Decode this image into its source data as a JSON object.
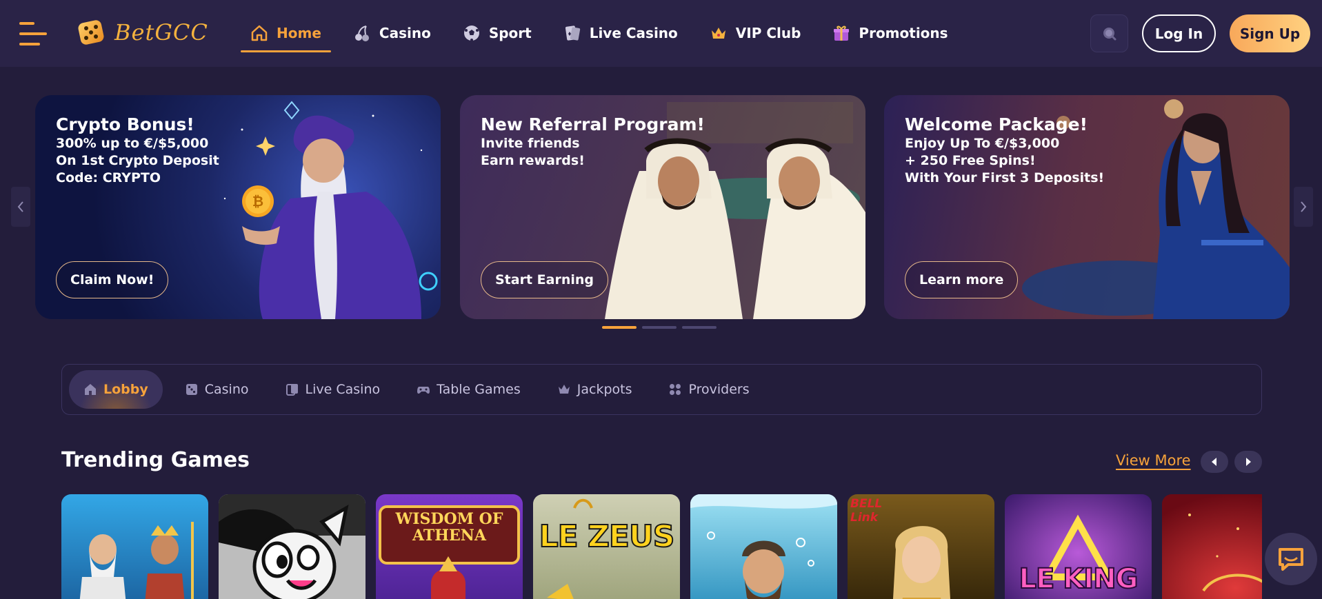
{
  "header": {
    "logo_text": "BetGCC",
    "nav": [
      {
        "label": "Home",
        "icon": "home-icon",
        "active": true
      },
      {
        "label": "Casino",
        "icon": "cherries-icon"
      },
      {
        "label": "Sport",
        "icon": "soccer-ball-icon"
      },
      {
        "label": "Live Casino",
        "icon": "card-hand-icon"
      },
      {
        "label": "VIP Club",
        "icon": "crown-icon"
      },
      {
        "label": "Promotions",
        "icon": "gift-icon"
      }
    ],
    "login_label": "Log In",
    "signup_label": "Sign Up"
  },
  "banners": [
    {
      "title": "Crypto Bonus!",
      "lines": [
        "300% up to €/$5,000",
        "On 1st Crypto Deposit",
        "Code: CRYPTO"
      ],
      "button": "Claim Now!"
    },
    {
      "title": "New Referral Program!",
      "lines": [
        "Invite friends",
        "Earn rewards!"
      ],
      "button": "Start Earning"
    },
    {
      "title": "Welcome Package!",
      "lines": [
        "Enjoy Up To €/$3,000",
        "+ 250 Free Spins!",
        "With Your First 3 Deposits!"
      ],
      "button": "Learn more"
    }
  ],
  "carousel": {
    "total_pages": 3,
    "active_page": 1
  },
  "categories": [
    {
      "label": "Lobby",
      "icon": "lobby-home-icon",
      "active": true
    },
    {
      "label": "Casino",
      "icon": "dice-icon"
    },
    {
      "label": "Live Casino",
      "icon": "live-cards-icon"
    },
    {
      "label": "Table Games",
      "icon": "gamepad-icon"
    },
    {
      "label": "Jackpots",
      "icon": "jackpot-crown-icon"
    },
    {
      "label": "Providers",
      "icon": "providers-grid-icon"
    }
  ],
  "trending": {
    "title": "Trending Games",
    "view_more": "View More"
  },
  "games": [
    {
      "label": "",
      "theme": "gods"
    },
    {
      "label": "",
      "theme": "cartoon-cat"
    },
    {
      "label": "WISDOM OF ATHENA",
      "theme": "athena"
    },
    {
      "label": "LE ZEUS",
      "theme": "le-zeus"
    },
    {
      "label": "",
      "theme": "fisherman"
    },
    {
      "label": "BELL Link",
      "theme": "bell-link"
    },
    {
      "label": "LE KING",
      "theme": "le-king"
    },
    {
      "label": "",
      "theme": "red-royal"
    }
  ],
  "colors": {
    "accent": "#f6a23b",
    "background": "#231d3b",
    "header": "#2a2347"
  }
}
